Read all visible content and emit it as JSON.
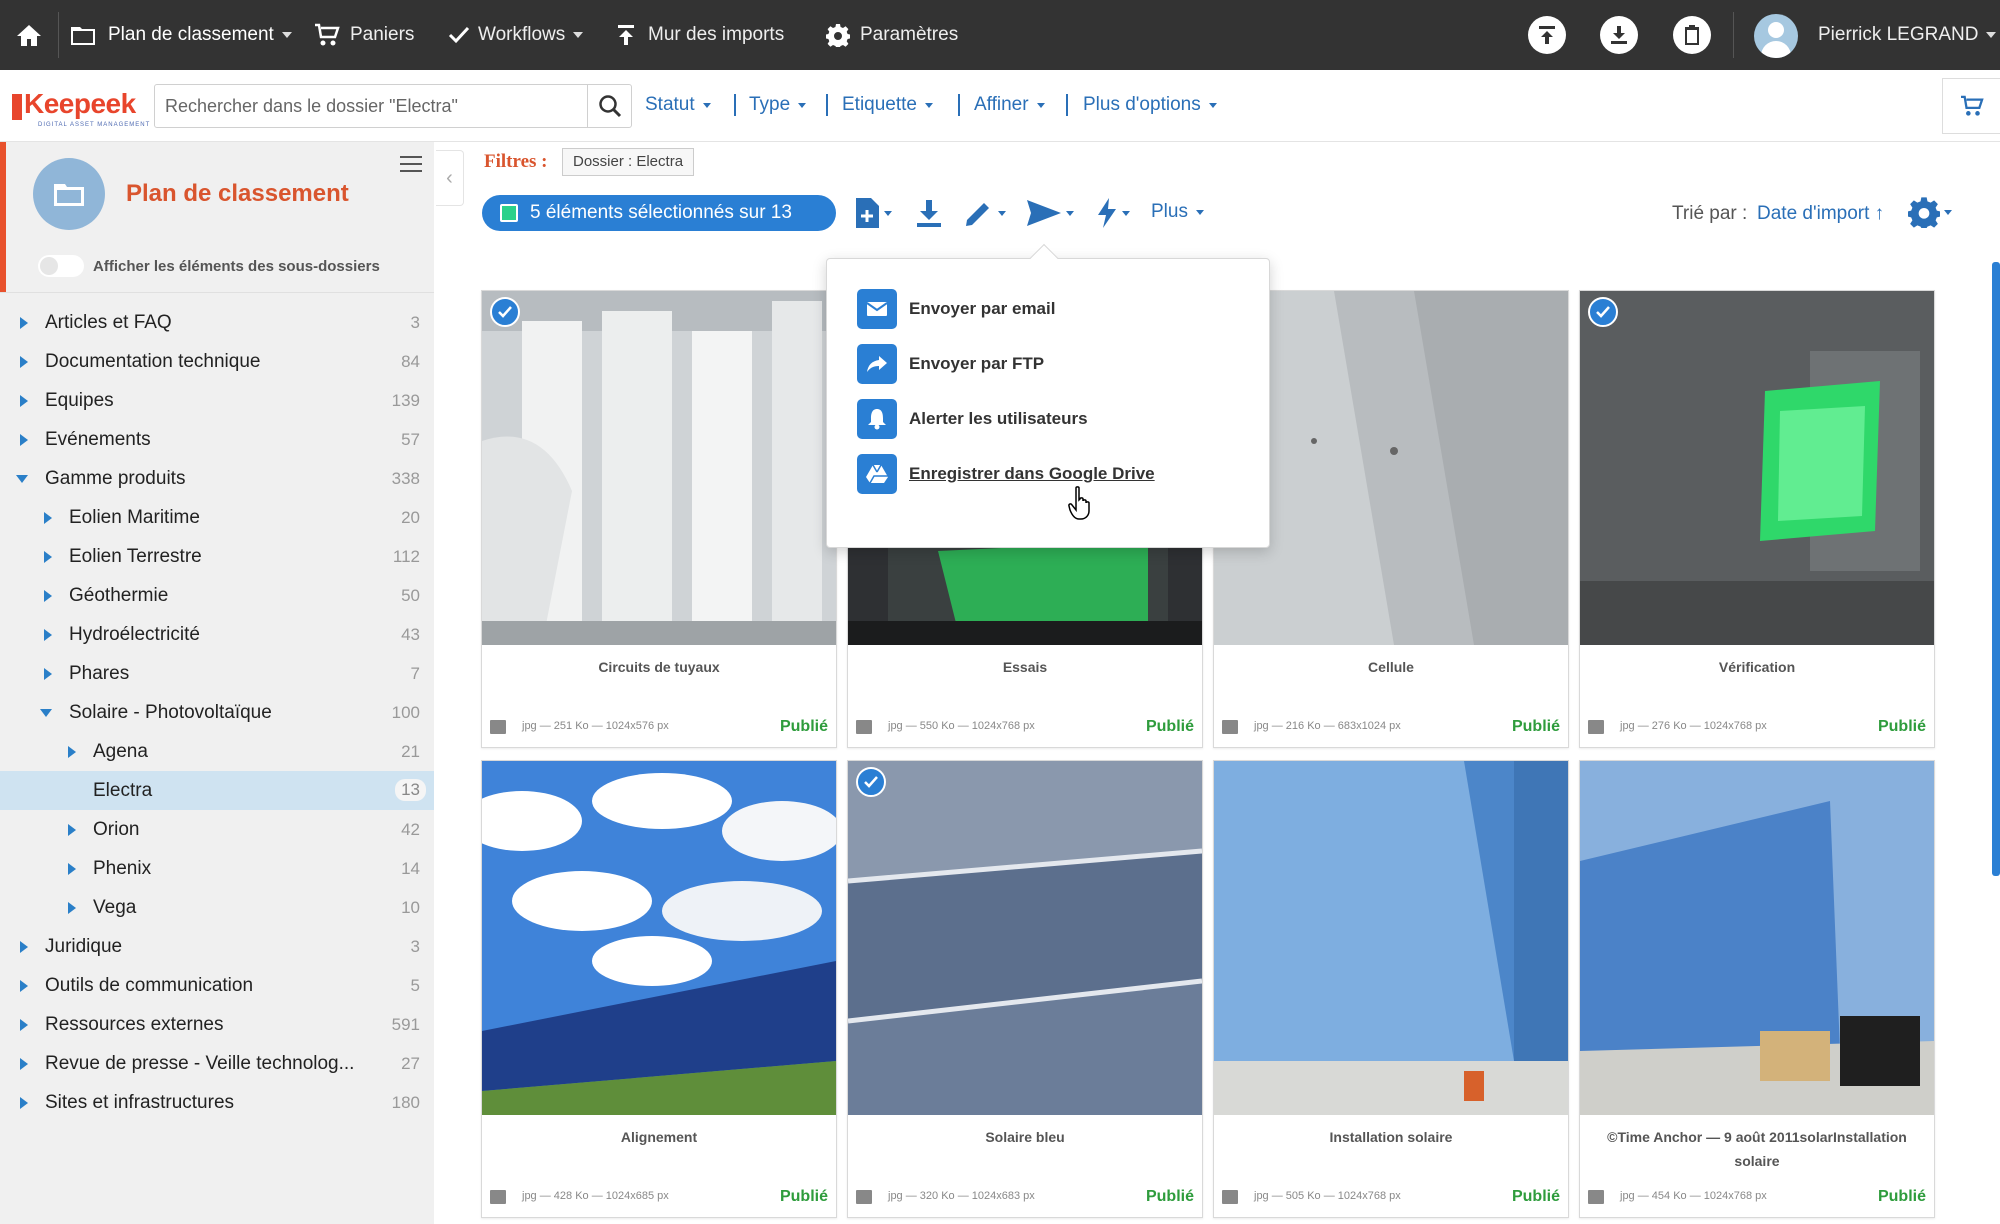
{
  "topbar": {
    "home_icon": "home-icon",
    "plan_label": "Plan de classement",
    "paniers_label": "Paniers",
    "workflows_label": "Workflows",
    "imports_label": "Mur des imports",
    "params_label": "Paramètres",
    "user_name": "Pierrick LEGRAND"
  },
  "header": {
    "logo_text": "Keepeek",
    "logo_tagline": "DIGITAL ASSET MANAGEMENT",
    "search_placeholder": "Rechercher dans le dossier \"Electra\"",
    "filters": [
      "Statut",
      "Type",
      "Etiquette",
      "Affiner",
      "Plus d'options"
    ]
  },
  "sidebar": {
    "title": "Plan de classement",
    "toggle_label": "Afficher les éléments des sous-dossiers",
    "tree": [
      {
        "label": "Articles et FAQ",
        "count": "3",
        "level": 0,
        "expanded": false
      },
      {
        "label": "Documentation technique",
        "count": "84",
        "level": 0,
        "expanded": false
      },
      {
        "label": "Equipes",
        "count": "139",
        "level": 0,
        "expanded": false
      },
      {
        "label": "Evénements",
        "count": "57",
        "level": 0,
        "expanded": false
      },
      {
        "label": "Gamme produits",
        "count": "338",
        "level": 0,
        "expanded": true
      },
      {
        "label": "Eolien Maritime",
        "count": "20",
        "level": 1,
        "expanded": false
      },
      {
        "label": "Eolien Terrestre",
        "count": "112",
        "level": 1,
        "expanded": false
      },
      {
        "label": "Géothermie",
        "count": "50",
        "level": 1,
        "expanded": false
      },
      {
        "label": "Hydroélectricité",
        "count": "43",
        "level": 1,
        "expanded": false
      },
      {
        "label": "Phares",
        "count": "7",
        "level": 1,
        "expanded": false
      },
      {
        "label": "Solaire - Photovoltaïque",
        "count": "100",
        "level": 1,
        "expanded": true
      },
      {
        "label": "Agena",
        "count": "21",
        "level": 2,
        "expanded": false
      },
      {
        "label": "Electra",
        "count": "13",
        "level": 2,
        "expanded": false,
        "selected": true,
        "leaf": true
      },
      {
        "label": "Orion",
        "count": "42",
        "level": 2,
        "expanded": false
      },
      {
        "label": "Phenix",
        "count": "14",
        "level": 2,
        "expanded": false
      },
      {
        "label": "Vega",
        "count": "10",
        "level": 2,
        "expanded": false
      },
      {
        "label": "Juridique",
        "count": "3",
        "level": 0,
        "expanded": false
      },
      {
        "label": "Outils de communication",
        "count": "5",
        "level": 0,
        "expanded": false
      },
      {
        "label": "Ressources externes",
        "count": "591",
        "level": 0,
        "expanded": false
      },
      {
        "label": "Revue de presse - Veille technolog...",
        "count": "27",
        "level": 0,
        "expanded": false
      },
      {
        "label": "Sites et infrastructures",
        "count": "180",
        "level": 0,
        "expanded": false
      }
    ]
  },
  "content": {
    "filters_label": "Filtres :",
    "filter_chip": "Dossier : Electra",
    "selection_label": "5 éléments sélectionnés sur 13",
    "more_label": "Plus",
    "sort_label": "Trié par :",
    "sort_value": "Date d'import ↑"
  },
  "popup": {
    "items": [
      {
        "label": "Envoyer par email",
        "icon": "envelope-icon"
      },
      {
        "label": "Envoyer par FTP",
        "icon": "share-arrow-icon"
      },
      {
        "label": "Alerter les utilisateurs",
        "icon": "bell-icon"
      },
      {
        "label": "Enregistrer dans Google Drive",
        "icon": "google-drive-icon"
      }
    ]
  },
  "cards": [
    {
      "title": "Circuits de tuyaux",
      "meta": "jpg — 251 Ko — 1024x576 px",
      "status": "Publié",
      "checked": true,
      "scene": "pipes"
    },
    {
      "title": "Essais",
      "meta": "jpg — 550 Ko — 1024x768 px",
      "status": "Publié",
      "checked": false,
      "scene": "test"
    },
    {
      "title": "Cellule",
      "meta": "jpg — 216 Ko — 683x1024 px",
      "status": "Publié",
      "checked": false,
      "scene": "cell"
    },
    {
      "title": "Vérification",
      "meta": "jpg — 276 Ko — 1024x768 px",
      "status": "Publié",
      "checked": true,
      "scene": "verif"
    },
    {
      "title": "Alignement",
      "meta": "jpg — 428 Ko — 1024x685 px",
      "status": "Publié",
      "checked": false,
      "scene": "align"
    },
    {
      "title": "Solaire bleu",
      "meta": "jpg — 320 Ko — 1024x683 px",
      "status": "Publié",
      "checked": true,
      "scene": "blue"
    },
    {
      "title": "Installation solaire",
      "meta": "jpg — 505 Ko — 1024x768 px",
      "status": "Publié",
      "checked": false,
      "scene": "install"
    },
    {
      "title": "©Time Anchor — 9 août 2011solarInstallation solaire",
      "meta": "jpg — 454 Ko — 1024x768 px",
      "status": "Publié",
      "checked": false,
      "scene": "install2"
    }
  ],
  "colors": {
    "accent": "#2a7fd4",
    "brand": "#e8452c",
    "published": "#2e9c3c",
    "topbar": "#333333"
  }
}
